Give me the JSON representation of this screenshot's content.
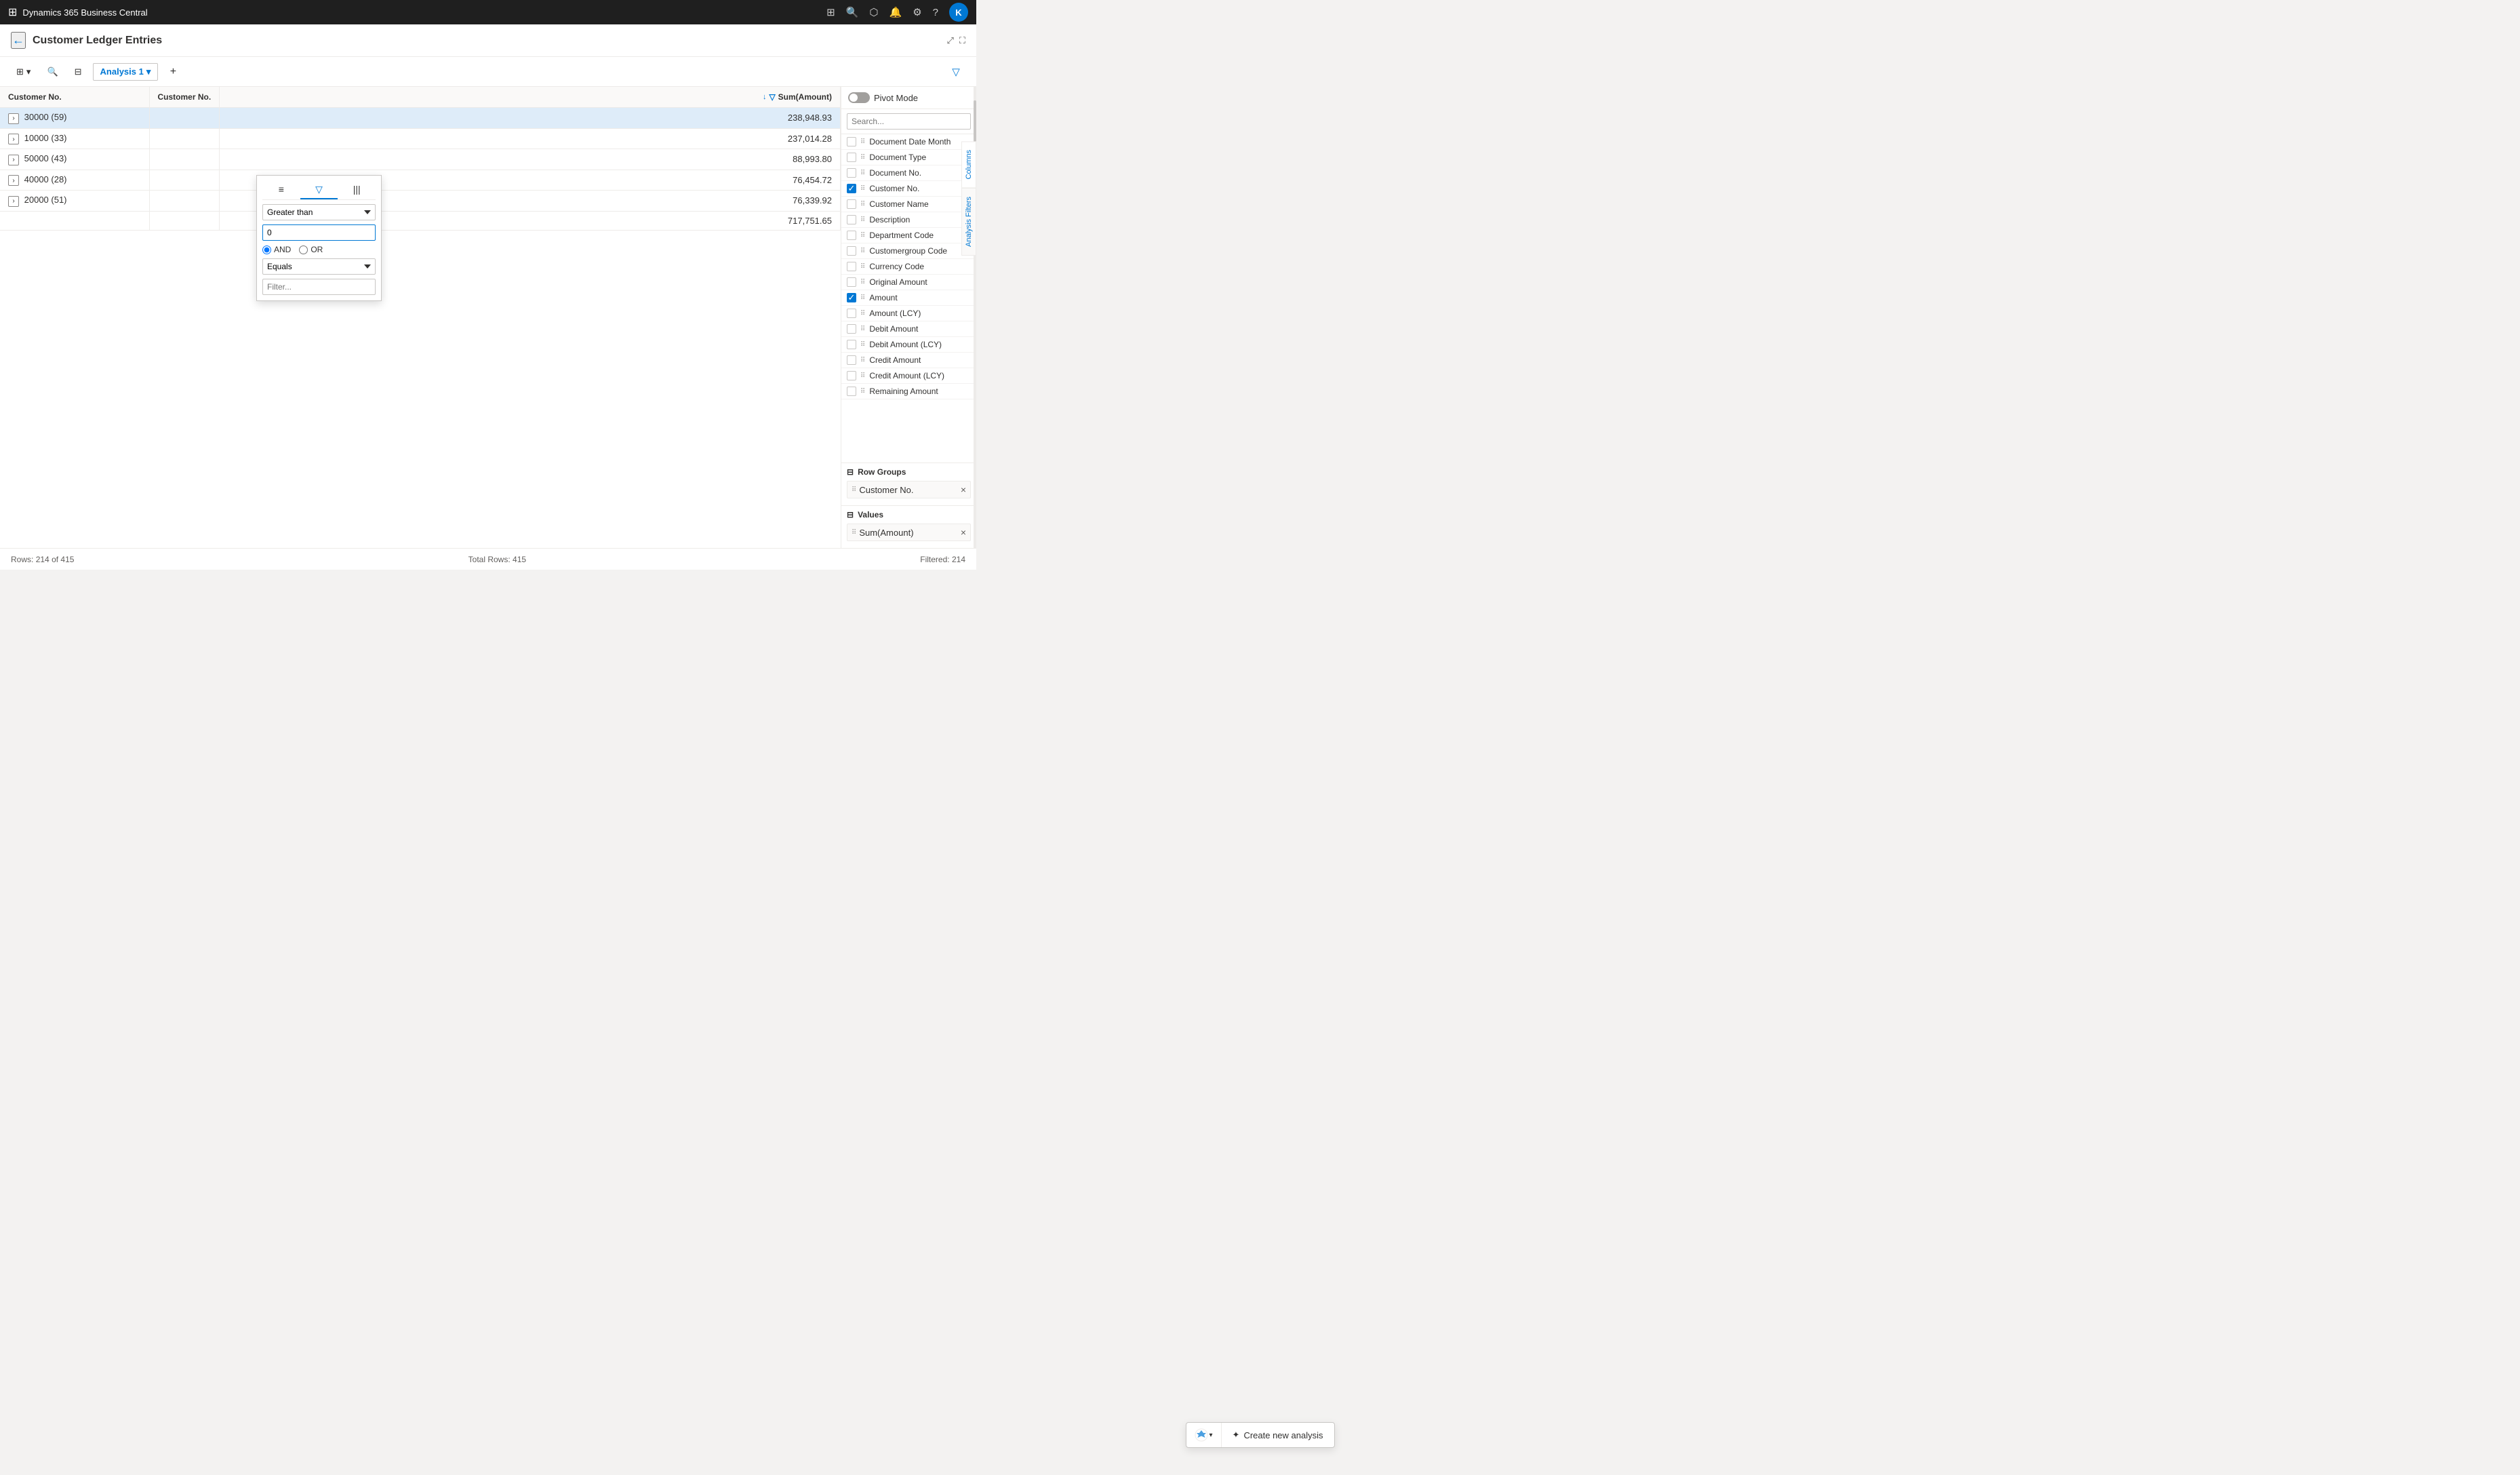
{
  "app": {
    "title": "Dynamics 365 Business Central",
    "icons": {
      "grid": "⊞",
      "search": "🔍",
      "bell": "🔔",
      "settings": "⚙",
      "help": "?",
      "avatar_letter": "K"
    }
  },
  "page": {
    "title": "Customer Ledger Entries",
    "back_label": "←"
  },
  "toolbar": {
    "view_icon": "⊞",
    "search_icon": "🔍",
    "save_icon": "💾",
    "analysis_tab_label": "Analysis 1",
    "plus_label": "+",
    "filter_icon": "▼"
  },
  "table": {
    "columns": [
      {
        "key": "customer_no",
        "label": "Customer No."
      },
      {
        "key": "customer_no2",
        "label": "Customer No."
      },
      {
        "key": "sum_amount",
        "label": "Sum(Amount)"
      }
    ],
    "rows": [
      {
        "id": "row1",
        "customer_no": "30000 (59)",
        "sum_amount": "238,948.93",
        "active": true
      },
      {
        "id": "row2",
        "customer_no": "10000 (33)",
        "sum_amount": "237,014.28",
        "active": false
      },
      {
        "id": "row3",
        "customer_no": "50000 (43)",
        "sum_amount": "88,993.80",
        "active": false
      },
      {
        "id": "row4",
        "customer_no": "40000 (28)",
        "sum_amount": "76,454.72",
        "active": false
      },
      {
        "id": "row5",
        "customer_no": "20000 (51)",
        "sum_amount": "76,339.92",
        "active": false
      }
    ],
    "total_row": {
      "sum_amount": "717,751.65"
    }
  },
  "filter_popup": {
    "tab_list_icon": "≡",
    "tab_filter_icon": "▽",
    "tab_columns_icon": "|||",
    "condition1": "Greater than",
    "value1": "0",
    "radio_and": "AND",
    "radio_or": "OR",
    "condition2": "Equals",
    "placeholder2": "Filter..."
  },
  "right_panel": {
    "pivot_label": "Pivot Mode",
    "search_placeholder": "Search...",
    "tabs": {
      "columns_label": "Columns",
      "analysis_filters_label": "Analysis Filters"
    },
    "fields": [
      {
        "id": "f1",
        "name": "Document Date Month",
        "checked": false
      },
      {
        "id": "f2",
        "name": "Document Type",
        "checked": false
      },
      {
        "id": "f3",
        "name": "Document No.",
        "checked": false
      },
      {
        "id": "f4",
        "name": "Customer No.",
        "checked": true
      },
      {
        "id": "f5",
        "name": "Customer Name",
        "checked": false
      },
      {
        "id": "f6",
        "name": "Description",
        "checked": false
      },
      {
        "id": "f7",
        "name": "Department Code",
        "checked": false
      },
      {
        "id": "f8",
        "name": "Customergroup Code",
        "checked": false
      },
      {
        "id": "f9",
        "name": "Currency Code",
        "checked": false
      },
      {
        "id": "f10",
        "name": "Original Amount",
        "checked": false
      },
      {
        "id": "f11",
        "name": "Amount",
        "checked": true
      },
      {
        "id": "f12",
        "name": "Amount (LCY)",
        "checked": false
      },
      {
        "id": "f13",
        "name": "Debit Amount",
        "checked": false
      },
      {
        "id": "f14",
        "name": "Debit Amount (LCY)",
        "checked": false
      },
      {
        "id": "f15",
        "name": "Credit Amount",
        "checked": false
      },
      {
        "id": "f16",
        "name": "Credit Amount (LCY)",
        "checked": false
      },
      {
        "id": "f17",
        "name": "Remaining Amount",
        "checked": false
      }
    ],
    "row_groups_label": "Row Groups",
    "row_group_item": "Customer No.",
    "values_label": "Values",
    "values_item": "Sum(Amount)"
  },
  "bottom_bar": {
    "rows_label": "Rows:",
    "rows_current": "214",
    "rows_separator": "of",
    "rows_total": "415",
    "total_rows_label": "Total Rows:",
    "total_rows_value": "415",
    "filtered_label": "Filtered:",
    "filtered_value": "214"
  },
  "create_analysis": {
    "label": "Create new analysis",
    "icon": "✦"
  }
}
